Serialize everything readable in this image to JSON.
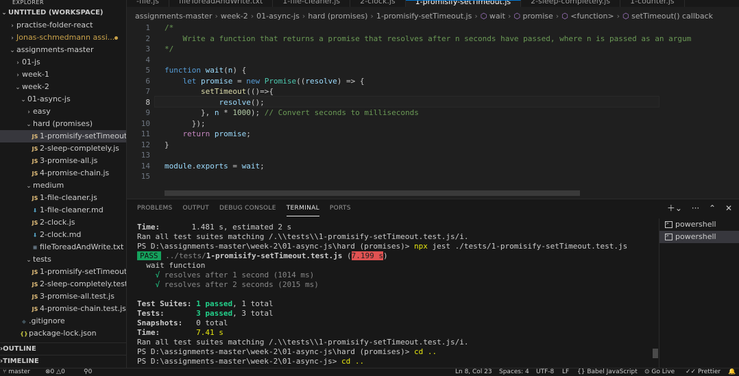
{
  "sidebar": {
    "title": "EXPLORER",
    "workspace": "UNTITLED (WORKSPACE)",
    "items": [
      {
        "label": "practise-folder-react",
        "type": "folder",
        "depth": 1
      },
      {
        "label": "Jonas-schmedmann assi...",
        "type": "folder",
        "depth": 1,
        "modified": true
      },
      {
        "label": "assignments-master",
        "type": "folder-open",
        "depth": 1
      },
      {
        "label": "01-js",
        "type": "folder",
        "depth": 2
      },
      {
        "label": "week-1",
        "type": "folder",
        "depth": 2
      },
      {
        "label": "week-2",
        "type": "folder-open",
        "depth": 2
      },
      {
        "label": "01-async-js",
        "type": "folder-open",
        "depth": 3
      },
      {
        "label": "easy",
        "type": "folder",
        "depth": 4
      },
      {
        "label": "hard (promises)",
        "type": "folder-open",
        "depth": 4
      },
      {
        "label": "1-promisify-setTimeout.js",
        "type": "js",
        "depth": 5,
        "active": true
      },
      {
        "label": "2-sleep-completely.js",
        "type": "js",
        "depth": 5
      },
      {
        "label": "3-promise-all.js",
        "type": "js",
        "depth": 5
      },
      {
        "label": "4-promise-chain.js",
        "type": "js",
        "depth": 5
      },
      {
        "label": "medium",
        "type": "folder-open",
        "depth": 4
      },
      {
        "label": "1-file-cleaner.js",
        "type": "js",
        "depth": 5
      },
      {
        "label": "1-file-cleaner.md",
        "type": "md",
        "depth": 5
      },
      {
        "label": "2-clock.js",
        "type": "js",
        "depth": 5
      },
      {
        "label": "2-clock.md",
        "type": "md",
        "depth": 5
      },
      {
        "label": "fileToreadAndWrite.txt",
        "type": "txt",
        "depth": 5
      },
      {
        "label": "tests",
        "type": "folder-open",
        "depth": 4
      },
      {
        "label": "1-promisify-setTimeout.t...",
        "type": "js",
        "depth": 5
      },
      {
        "label": "2-sleep-completely.test.js",
        "type": "js",
        "depth": 5
      },
      {
        "label": "3-promise-all.test.js",
        "type": "js",
        "depth": 5
      },
      {
        "label": "4-promise-chain.test.js",
        "type": "js",
        "depth": 5
      },
      {
        "label": ".gitignore",
        "type": "git",
        "depth": 3
      },
      {
        "label": "package-lock.json",
        "type": "json",
        "depth": 3
      }
    ],
    "outline": "OUTLINE",
    "timeline": "TIMELINE"
  },
  "tabs": [
    {
      "label": "-file.js",
      "active": false
    },
    {
      "label": "fileToreadAndWrite.txt",
      "active": false
    },
    {
      "label": "1-file-cleaner.js",
      "active": false
    },
    {
      "label": "2-clock.js",
      "active": false
    },
    {
      "label": "1-promisify-setTimeout.js",
      "active": true
    },
    {
      "label": "2-sleep-completely.js",
      "active": false
    },
    {
      "label": "1-counter.js",
      "active": false
    }
  ],
  "breadcrumb": {
    "parts": [
      "assignments-master",
      "week-2",
      "01-async-js",
      "hard (promises)",
      "1-promisify-setTimeout.js"
    ],
    "symbols": [
      "wait",
      "promise",
      "<function>",
      "setTimeout() callback"
    ]
  },
  "editor": {
    "line_numbers": [
      "1",
      "2",
      "3",
      "4",
      "5",
      "6",
      "7",
      "8",
      "9",
      "10",
      "11",
      "12",
      "13",
      "14",
      "15"
    ],
    "current_line": 8,
    "lines": [
      "/*",
      "    Write a function that returns a promise that resolves after n seconds have passed, where n is passed as an argum",
      "*/",
      "",
      "function wait(n) {",
      "    let promise = new Promise((resolve) => {",
      "        setTimeout(()=>{",
      "            resolve();",
      "        }, n * 1000); // Convert seconds to milliseconds",
      "      });",
      "    return promise;",
      "}",
      "",
      "module.exports = wait;",
      ""
    ]
  },
  "panel": {
    "tabs": [
      "PROBLEMS",
      "OUTPUT",
      "DEBUG CONSOLE",
      "TERMINAL",
      "PORTS"
    ],
    "active_tab": "TERMINAL",
    "terminals": [
      "powershell",
      "powershell"
    ],
    "terminal": {
      "l1_label": "Time:",
      "l1_value": "1.481 s, estimated 2 s",
      "l2": "Ran all test suites matching /.\\\\tests\\\\1-promisify-setTimeout.test.js/i.",
      "l3_prompt": "PS D:\\assignments-master\\week-2\\01-async-js\\hard (promises)> ",
      "l3_cmd": "npx",
      "l3_args": " jest ./tests/1-promisify-setTimeout.test.js",
      "l4_badge": "PASS",
      "l4_path": " ../tests/",
      "l4_file": "1-promisify-setTimeout.test.js",
      "l4_open": " (",
      "l4_time": "7.199 s",
      "l4_close": ")",
      "l5": "  wait function",
      "l6_check": "    √",
      "l6_text": " resolves after 1 second (1014 ms)",
      "l7_check": "    √",
      "l7_text": " resolves after 2 seconds (2015 ms)",
      "l8": "",
      "l9_label": "Test Suites: ",
      "l9_pass": "1 passed",
      "l9_rest": ", 1 total",
      "l10_label": "Tests:       ",
      "l10_pass": "3 passed",
      "l10_rest": ", 3 total",
      "l11_label": "Snapshots:   ",
      "l11_rest": "0 total",
      "l12_label": "Time:        ",
      "l12_value": "7.41 s",
      "l13": "Ran all test suites matching /.\\\\tests\\\\1-promisify-setTimeout.test.js/i.",
      "l14_prompt": "PS D:\\assignments-master\\week-2\\01-async-js\\hard (promises)> ",
      "l14_cmd": "cd ..",
      "l15_prompt": "PS D:\\assignments-master\\week-2\\01-async-js> ",
      "l15_cmd": "cd .."
    }
  },
  "status": {
    "branch": "master",
    "errors": "0",
    "warnings": "0",
    "ports": "0",
    "position": "Ln 8, Col 23",
    "spaces": "Spaces: 4",
    "encoding": "UTF-8",
    "eol": "LF",
    "language": "{} Babel JavaScript",
    "golive": "Go Live",
    "prettier": "Prettier"
  }
}
